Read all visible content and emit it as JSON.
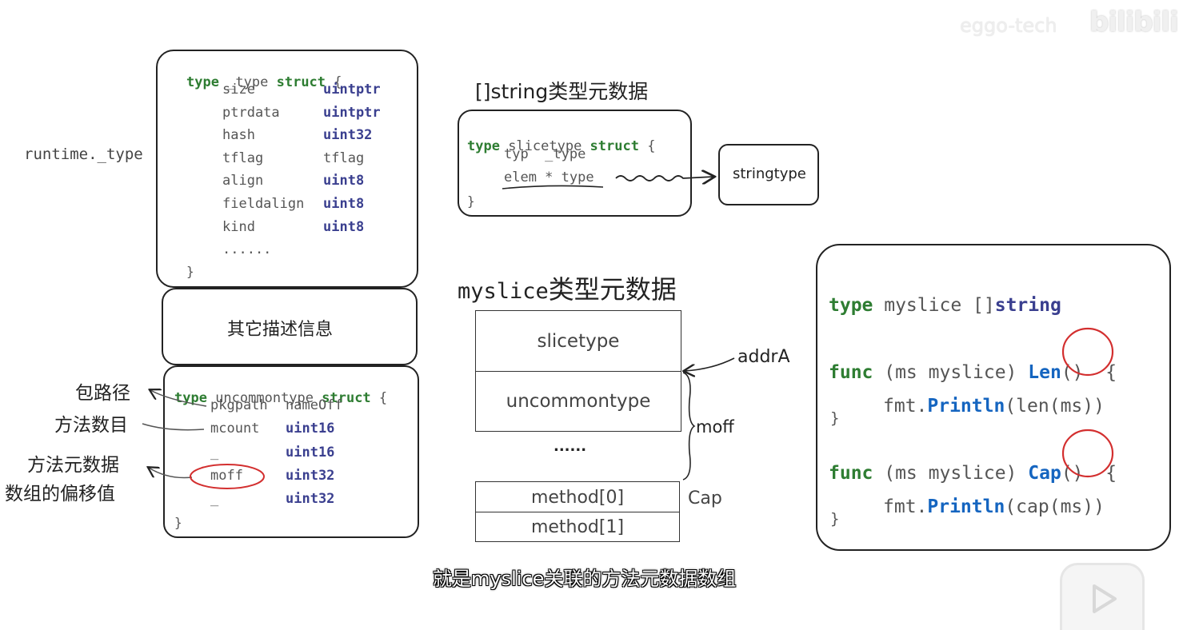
{
  "watermark": {
    "brand": "eggo-tech",
    "logo": "bilibili"
  },
  "runtime_label": "runtime._type",
  "type_struct": {
    "header_kw": "type",
    "header_name": " _type ",
    "header_struct": "struct",
    "header_brace": " {",
    "fields": [
      {
        "name": "size",
        "type": "uintptr",
        "bold": true
      },
      {
        "name": "ptrdata",
        "type": "uintptr",
        "bold": true
      },
      {
        "name": "hash",
        "type": "uint32",
        "bold": true
      },
      {
        "name": "tflag",
        "type": "tflag",
        "bold": false
      },
      {
        "name": "align",
        "type": "uint8",
        "bold": true
      },
      {
        "name": "fieldalign",
        "type": "uint8",
        "bold": true
      },
      {
        "name": "kind",
        "type": "uint8",
        "bold": true
      }
    ],
    "ellipsis": "......",
    "close": "}"
  },
  "other_info": "其它描述信息",
  "uncommon": {
    "header_kw": "type",
    "header_name": " uncommontype ",
    "header_struct": "struct",
    "header_brace": " {",
    "fields": [
      {
        "name": "pkgpath",
        "type": "nameOff",
        "bold": false
      },
      {
        "name": "mcount",
        "type": "uint16",
        "bold": true
      },
      {
        "name": "_",
        "type": "uint16",
        "bold": true
      },
      {
        "name": "moff",
        "type": "uint32",
        "bold": true
      },
      {
        "name": "_",
        "type": "uint32",
        "bold": true
      }
    ],
    "close": "}"
  },
  "annotations": {
    "pkgpath": "包路径",
    "mcount": "方法数目",
    "moff_line1": "方法元数据",
    "moff_line2": "数组的偏移值"
  },
  "slicetype_title": "[]string类型元数据",
  "slicetype": {
    "header_kw": "type",
    "header_name": " slicetype ",
    "header_struct": "struct",
    "header_brace": " {",
    "field1": "typ  _type",
    "field2": "elem * type",
    "close": "}"
  },
  "stringtype_label": "stringtype",
  "myslice_title_mono": "myslice",
  "myslice_title_cjk": "类型元数据",
  "layout_cells": {
    "slicetype": "slicetype",
    "uncommontype": "uncommontype",
    "dots": "......",
    "method0": "method[0]",
    "method1": "method[1]"
  },
  "addrA_label": "addrA",
  "moff_label": "moff",
  "cap_label": "Cap",
  "code_panel": {
    "line1_kw": "type",
    "line1_rest": " myslice []",
    "line1_type": "string",
    "func_kw": "func",
    "func_recv": " (ms myslice) ",
    "len_name": "Len",
    "cap_name": "Cap",
    "func_tail": "()  {",
    "body_pkg": "fmt.",
    "body_fn": "Println",
    "len_args": "(len(ms))",
    "cap_args": "(cap(ms))",
    "close": "}"
  },
  "subtitle": "就是myslice关联的方法元数据数组",
  "colors": {
    "keyword": "#2e7d32",
    "type": "#3a3f8f",
    "func": "#1565c0",
    "circle": "#d32f2f"
  }
}
